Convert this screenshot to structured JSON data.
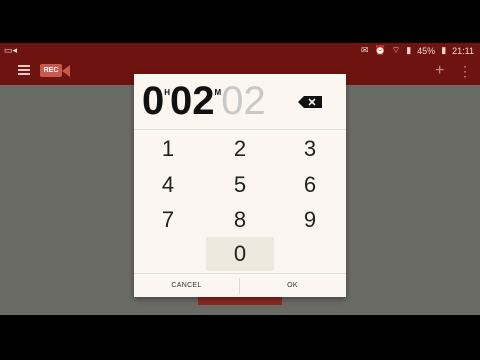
{
  "status": {
    "battery": "45%",
    "time": "21:11"
  },
  "picker": {
    "hours": "0",
    "hours_unit": "H",
    "minutes": "02",
    "minutes_unit": "M",
    "seconds": "02"
  },
  "keypad": [
    "1",
    "2",
    "3",
    "4",
    "5",
    "6",
    "7",
    "8",
    "9",
    "0"
  ],
  "actions": {
    "cancel": "CANCEL",
    "ok": "OK"
  },
  "colors": {
    "appbar": "#6e1410",
    "dialog": "#fbf7f0"
  }
}
